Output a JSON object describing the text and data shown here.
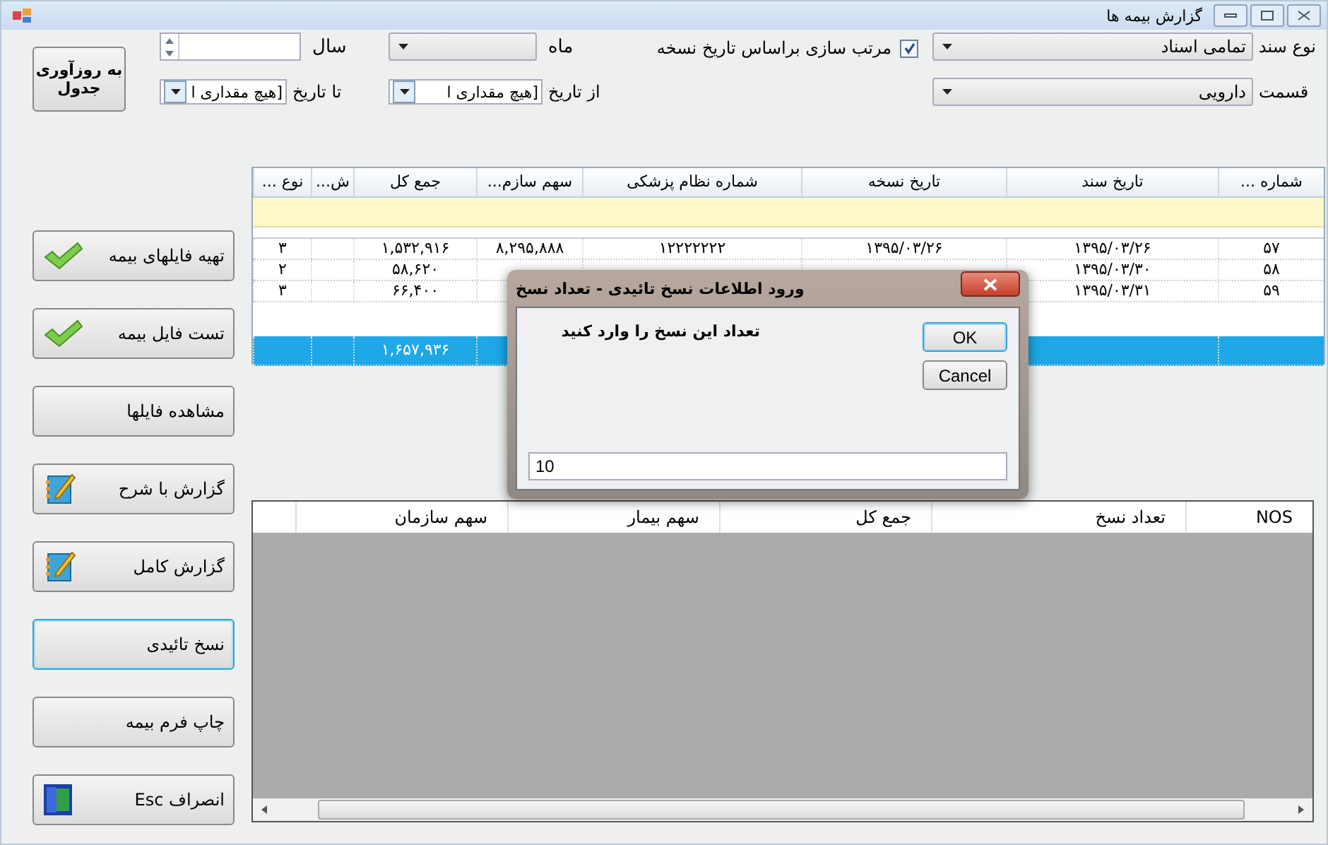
{
  "window": {
    "title": "گزارش بیمه ها"
  },
  "filters": {
    "doc_type": {
      "label": "نوع سند",
      "value": "تمامی اسناد"
    },
    "section": {
      "label": "قسمت",
      "value": "دارویی"
    },
    "sort_checkbox": {
      "label": "مرتب سازی براساس تاریخ نسخه",
      "checked": true
    },
    "month": {
      "label": "ماه"
    },
    "from_date": {
      "label": "از تاریخ",
      "value": "[هیچ مقداری ا"
    },
    "year": {
      "label": "سال"
    },
    "to_date": {
      "label": "تا تاریخ",
      "value": "[هیچ مقداری ا"
    },
    "refresh_button": "به روزآوری جدول"
  },
  "sidebar": [
    {
      "label": "تهیه فایلهای بیمه",
      "kind": "check",
      "focused": false
    },
    {
      "label": "تست فایل بیمه",
      "kind": "check",
      "focused": false
    },
    {
      "label": "مشاهده فایلها",
      "kind": "plain",
      "focused": false
    },
    {
      "label": "گزارش با شرح",
      "kind": "notepad",
      "focused": false
    },
    {
      "label": "گزارش کامل",
      "kind": "notepad",
      "focused": false
    },
    {
      "label": "نسخ تائیدی",
      "kind": "plain",
      "focused": true
    },
    {
      "label": "چاپ فرم بیمه",
      "kind": "plain",
      "focused": false
    },
    {
      "label": "انصراف  Esc",
      "kind": "door",
      "focused": false
    }
  ],
  "grid": {
    "columns": [
      "شماره ...",
      "تاریخ سند",
      "تاریخ نسخه",
      "شماره نظام پزشکی",
      "سهم سازم...",
      "جمع کل",
      "ش...",
      "نوع ..."
    ],
    "rows": [
      {
        "selected": false,
        "cells": [
          "۵۷",
          "۱۳۹۵/۰۳/۲۶",
          "۱۳۹۵/۰۳/۲۶",
          "۱۲۲۲۲۲۲۲",
          "۸,۲۹۵,۸۸۸",
          "۱,۵۳۲,۹۱۶",
          null,
          "۳"
        ]
      },
      {
        "selected": false,
        "cells": [
          "۵۸",
          "۱۳۹۵/۰۳/۳۰",
          null,
          null,
          null,
          "۵۸,۶۲۰",
          null,
          "۲"
        ]
      },
      {
        "selected": false,
        "cells": [
          "۵۹",
          "۱۳۹۵/۰۳/۳۱",
          null,
          null,
          null,
          "۶۶,۴۰۰",
          null,
          "۳"
        ]
      }
    ],
    "total": {
      "selected": true,
      "cells": [
        null,
        null,
        null,
        null,
        null,
        "۱,۶۵۷,۹۳۶",
        null,
        null
      ]
    }
  },
  "lower_grid": {
    "columns": [
      "NOS",
      "تعداد نسخ",
      "جمع کل",
      "سهم بیمار",
      "سهم سازمان"
    ]
  },
  "dialog": {
    "title": "ورود اطلاعات نسخ تائیدی - تعداد نسخ",
    "message": "تعداد این نسخ را وارد کنید",
    "buttons": [
      {
        "label": "OK",
        "default": true
      },
      {
        "label": "Cancel",
        "default": false
      }
    ],
    "value": "10"
  }
}
